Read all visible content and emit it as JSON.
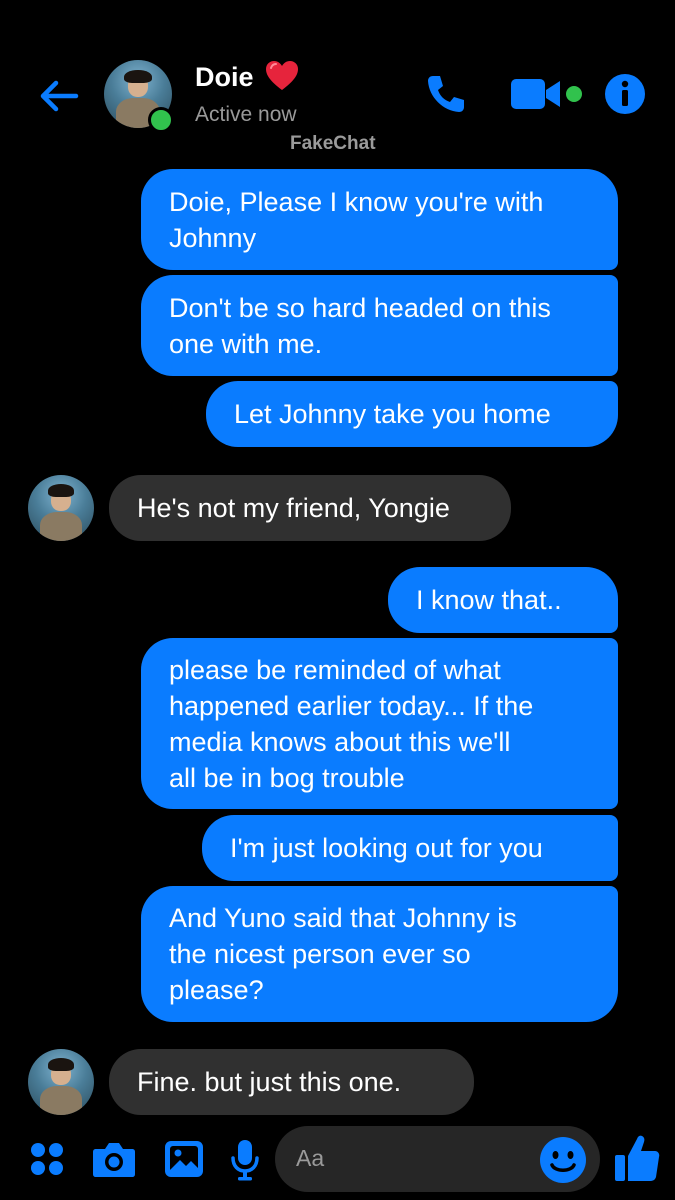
{
  "header": {
    "contact_name": "Doie",
    "status": "Active now",
    "watermark": "FakeChat"
  },
  "colors": {
    "accent": "#0a7cff",
    "outgoing_bubble": "#0a7cff",
    "incoming_bubble": "#303030",
    "online": "#31c24d",
    "background": "#000000"
  },
  "icons": {
    "back": "back-arrow-icon",
    "heart": "heart-icon",
    "call": "phone-icon",
    "video": "video-camera-icon",
    "info": "info-icon",
    "more": "four-dots-icon",
    "camera": "camera-icon",
    "gallery": "image-icon",
    "mic": "microphone-icon",
    "emoji": "smiley-icon",
    "like": "thumbs-up-icon"
  },
  "messages": [
    {
      "from": "me",
      "lines": [
        "Doie,  Please I know you're with",
        "Johnny"
      ]
    },
    {
      "from": "me",
      "lines": [
        "Don't be so hard headed on this",
        "one with me."
      ]
    },
    {
      "from": "me",
      "lines": [
        "Let Johnny take you home"
      ]
    },
    {
      "from": "them",
      "lines": [
        "He's not my friend, Yongie"
      ]
    },
    {
      "from": "me",
      "lines": [
        "I know that.."
      ]
    },
    {
      "from": "me",
      "lines": [
        "please be reminded of what",
        "happened earlier today... If the",
        "media knows about this we'll",
        "all be in bog trouble"
      ]
    },
    {
      "from": "me",
      "lines": [
        "I'm just looking out for you"
      ]
    },
    {
      "from": "me",
      "lines": [
        "And Yuno said that Johnny is",
        "the nicest person ever so",
        "please?"
      ]
    },
    {
      "from": "them",
      "lines": [
        "Fine. but just this one."
      ]
    }
  ],
  "composer": {
    "placeholder": "Aa"
  }
}
